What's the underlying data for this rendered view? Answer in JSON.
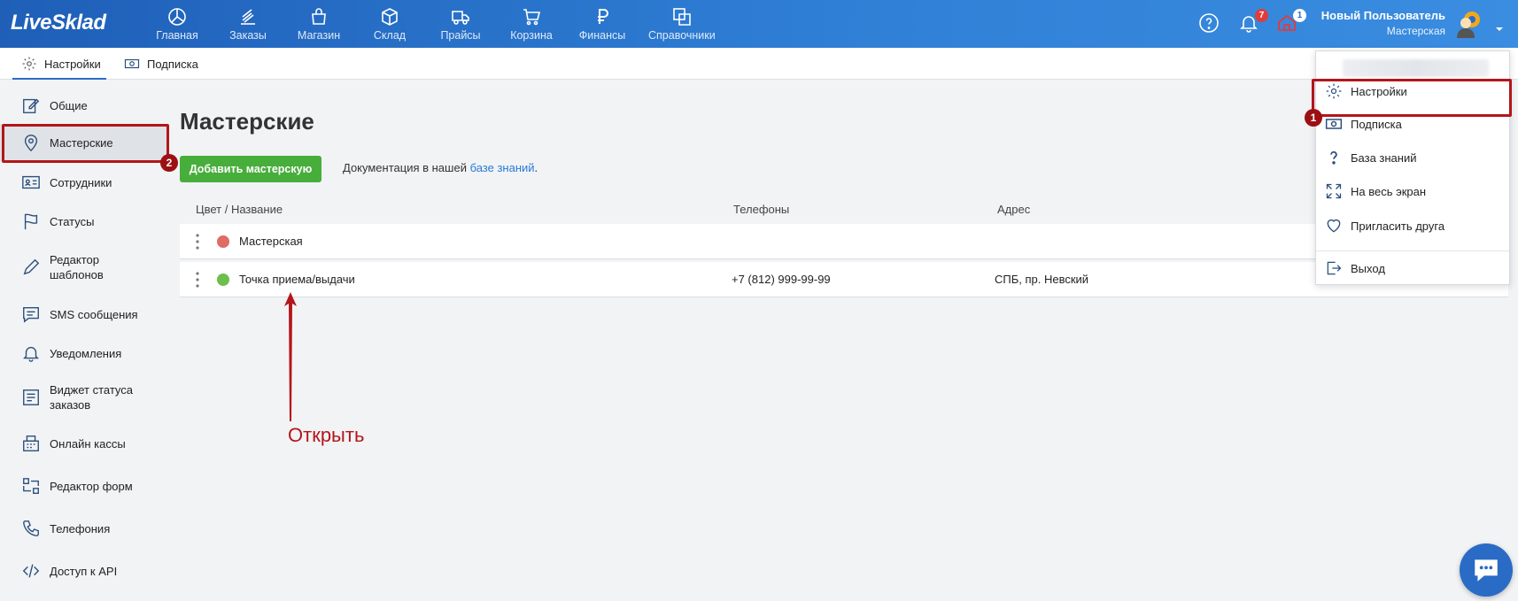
{
  "app": {
    "logo": "LiveSklad"
  },
  "nav": [
    {
      "label": "Главная",
      "icon": "dashboard-icon"
    },
    {
      "label": "Заказы",
      "icon": "orders-icon"
    },
    {
      "label": "Магазин",
      "icon": "shop-bag-icon"
    },
    {
      "label": "Склад",
      "icon": "box-icon"
    },
    {
      "label": "Прайсы",
      "icon": "truck-icon"
    },
    {
      "label": "Корзина",
      "icon": "cart-icon"
    },
    {
      "label": "Финансы",
      "icon": "ruble-icon"
    },
    {
      "label": "Справочники",
      "icon": "copy-icon"
    }
  ],
  "topbar": {
    "notifications_count": "7",
    "shop_count": "1",
    "user_name": "Новый Пользователь",
    "user_role": "Мастерская"
  },
  "subtabs": [
    {
      "label": "Настройки",
      "icon": "gear-icon",
      "active": true
    },
    {
      "label": "Подписка",
      "icon": "money-icon",
      "active": false
    }
  ],
  "sidebar": {
    "items": [
      {
        "label": "Общие",
        "icon": "edit-icon"
      },
      {
        "label": "Мастерские",
        "icon": "map-pin-icon",
        "active": true
      },
      {
        "label": "Сотрудники",
        "icon": "id-card-icon"
      },
      {
        "label": "Статусы",
        "icon": "flag-icon"
      },
      {
        "label": "Редактор шаблонов",
        "icon": "pencil-icon"
      },
      {
        "label": "SMS сообщения",
        "icon": "sms-icon"
      },
      {
        "label": "Уведомления",
        "icon": "bell-icon"
      },
      {
        "label": "Виджет статуса заказов",
        "icon": "widget-icon"
      },
      {
        "label": "Онлайн кассы",
        "icon": "cash-register-icon"
      },
      {
        "label": "Редактор форм",
        "icon": "form-editor-icon"
      },
      {
        "label": "Телефония",
        "icon": "phone-icon"
      },
      {
        "label": "Доступ к API",
        "icon": "code-icon"
      }
    ]
  },
  "main": {
    "title": "Мастерские",
    "add_button": "Добавить мастерскую",
    "doc_prefix": "Документация в нашей ",
    "doc_link": "базе знаний",
    "doc_suffix": ".",
    "columns": [
      "Цвет / Название",
      "Телефоны",
      "Адрес"
    ],
    "rows": [
      {
        "name": "Мастерская",
        "color": "#e06c66",
        "phone": "",
        "address": ""
      },
      {
        "name": "Точка приема/выдачи",
        "color": "#6cbf4c",
        "phone": "+7 (812) 999-99-99",
        "address": "СПБ, пр. Невский"
      }
    ]
  },
  "annotations": {
    "arrow_label": "Открыть",
    "marker_1": "1",
    "marker_2": "2",
    "highlight_color": "#b3161a"
  },
  "dropdown": {
    "items": [
      {
        "label": "Настройки",
        "icon": "gear-icon"
      },
      {
        "label": "Подписка",
        "icon": "money-icon"
      },
      {
        "label": "База знаний",
        "icon": "question-icon"
      },
      {
        "label": "На весь экран",
        "icon": "fullscreen-icon"
      },
      {
        "label": "Пригласить друга",
        "icon": "heart-icon"
      },
      {
        "label": "Выход",
        "icon": "logout-icon"
      }
    ]
  },
  "colors": {
    "topbar": "#2a6bc6",
    "accent": "#2a7ad6",
    "green_button": "#47ad3b"
  }
}
